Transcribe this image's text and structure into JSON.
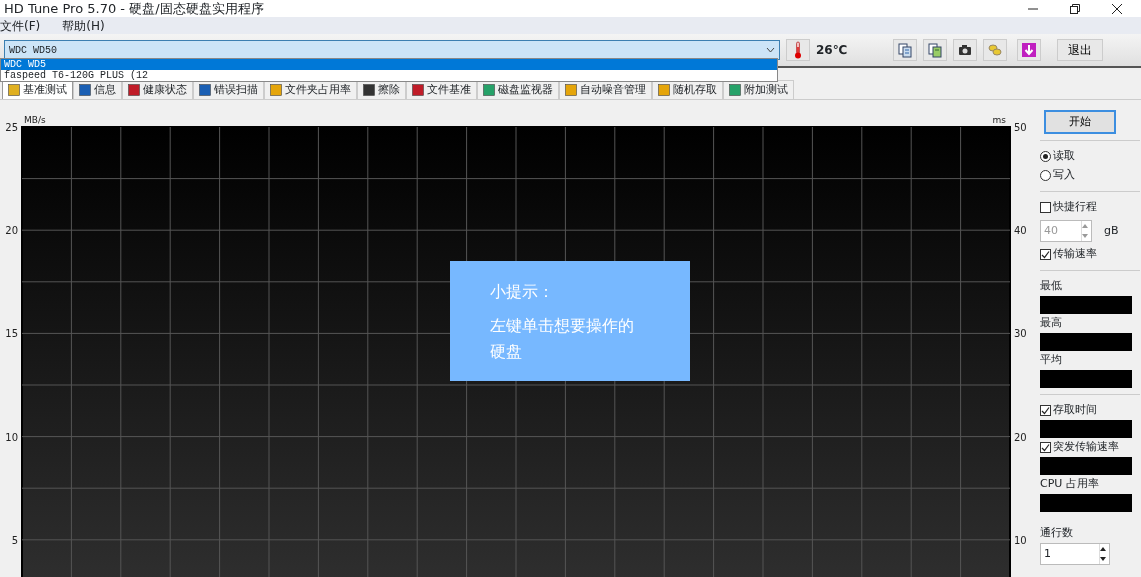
{
  "window": {
    "title": "HD Tune Pro 5.70 - 硬盘/固态硬盘实用程序"
  },
  "menu": [
    "文件(F)",
    "帮助(H)"
  ],
  "drive_select": {
    "value": "WDC WD50",
    "expanded": true,
    "options": [
      {
        "label": "WDC WD5",
        "selected": true
      },
      {
        "label": "faspeed T6-120G PLUS (12",
        "selected": false
      }
    ]
  },
  "temperature": "26℃",
  "toolbar": [
    {
      "kind": "copy"
    },
    {
      "kind": "copy-green"
    },
    {
      "kind": "camera"
    },
    {
      "kind": "coins"
    },
    {
      "kind": "download"
    }
  ],
  "exit_button": "退出",
  "tabs": [
    {
      "label": "基准测试",
      "selected": true
    },
    {
      "label": "信息",
      "selected": false
    },
    {
      "label": "健康状态",
      "selected": false
    },
    {
      "label": "错误扫描",
      "selected": false
    },
    {
      "label": "文件夹占用率",
      "selected": false
    },
    {
      "label": "擦除",
      "selected": false
    },
    {
      "label": "文件基准",
      "selected": false
    },
    {
      "label": "磁盘监视器",
      "selected": false
    },
    {
      "label": "自动噪音管理",
      "selected": false
    },
    {
      "label": "随机存取",
      "selected": false
    },
    {
      "label": "附加测试",
      "selected": false
    }
  ],
  "chart": {
    "left_unit": "MB/s",
    "left_ticks": [
      "25",
      "20",
      "15",
      "10",
      "5"
    ],
    "right_unit": "ms",
    "right_ticks": [
      "50",
      "40",
      "30",
      "20",
      "10"
    ]
  },
  "hint": {
    "title": "小提示：",
    "text": "左键单击想要操作的硬盘"
  },
  "panel": {
    "start_button": "开始",
    "modes": [
      {
        "label": "读取",
        "selected": true
      },
      {
        "label": "写入",
        "selected": false
      }
    ],
    "short_stroke": {
      "label": "快捷行程",
      "checked": false,
      "value": "40",
      "unit": "gB",
      "disabled": true
    },
    "transfer_rate": {
      "label": "传输速率",
      "checked": true
    },
    "stats": [
      "最低",
      "最高",
      "平均"
    ],
    "access_time": {
      "label": "存取时间",
      "checked": true
    },
    "burst_rate": {
      "label": "突发传输速率",
      "checked": true
    },
    "cpu_label": "CPU 占用率",
    "passes": {
      "label": "通行数",
      "value": "1"
    }
  }
}
